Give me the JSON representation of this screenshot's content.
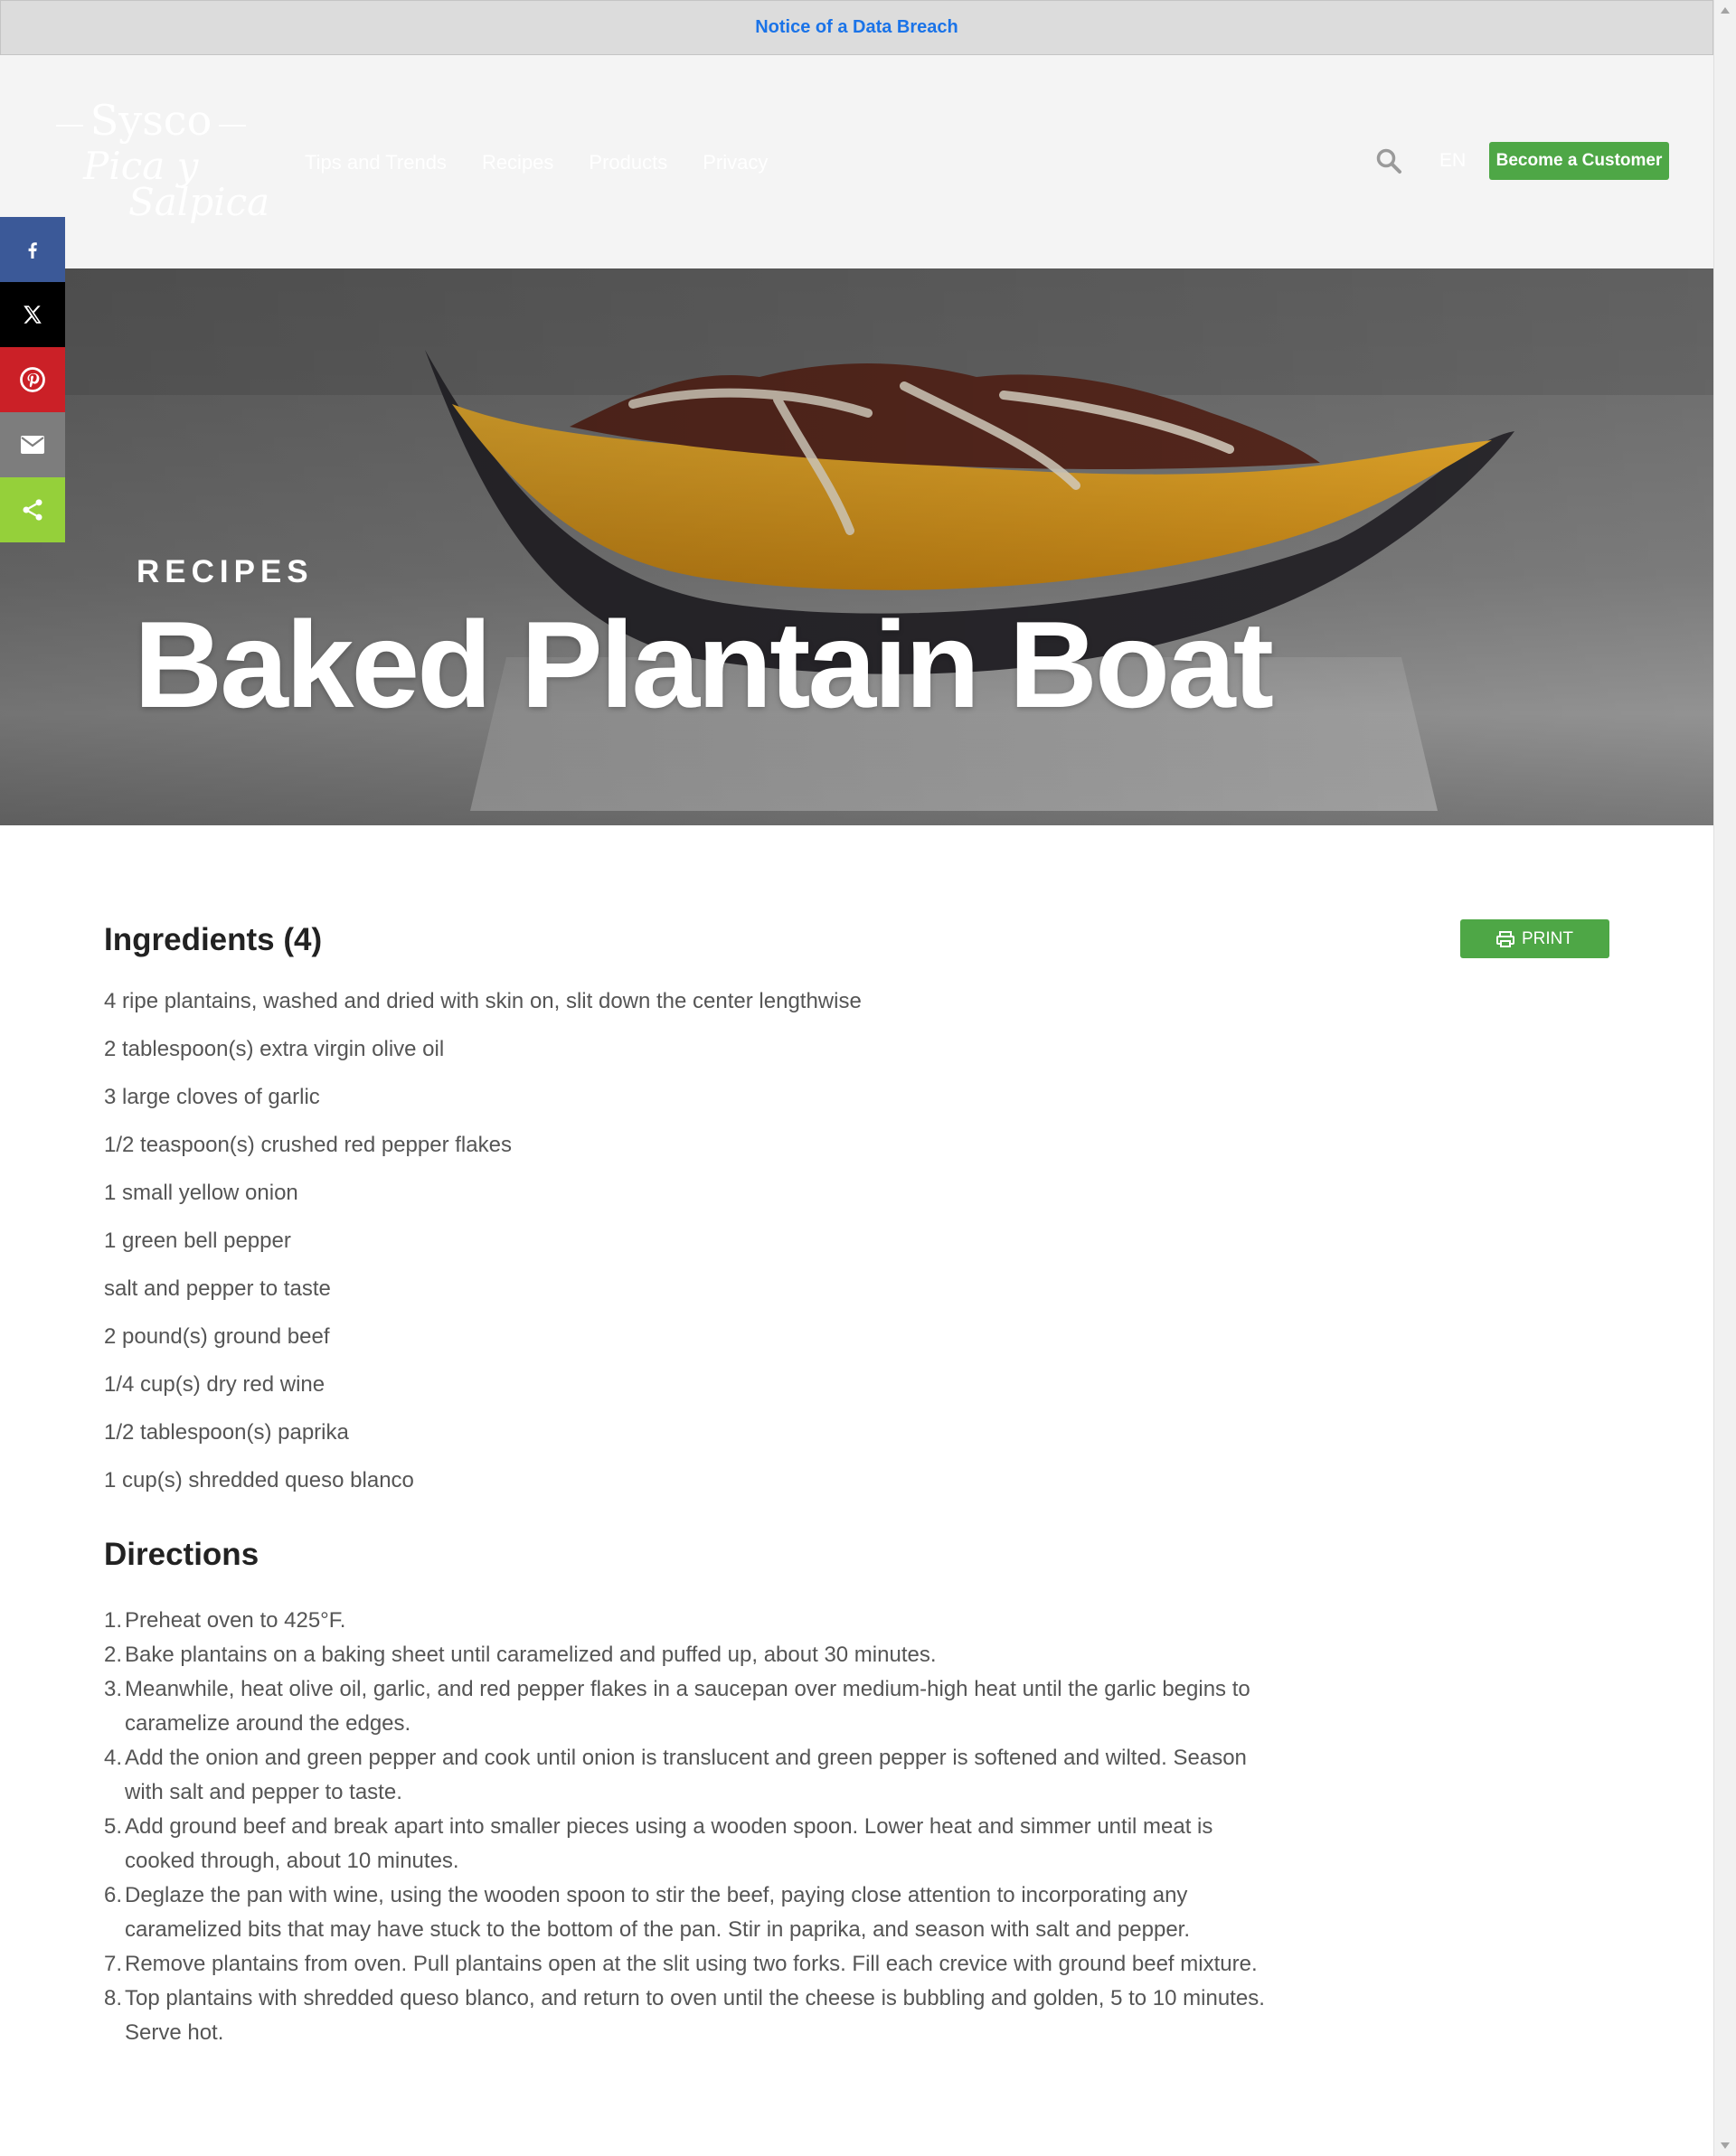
{
  "notice": {
    "label": "Notice of a Data Breach"
  },
  "header": {
    "logo": {
      "brand": "Sysco",
      "line1": "Pica y",
      "line2": "Salpica"
    },
    "nav": [
      "Tips and Trends",
      "Recipes",
      "Products",
      "Privacy"
    ],
    "search_icon": "search-icon",
    "language": "EN",
    "cta_label": "Become a Customer"
  },
  "social": [
    "facebook-icon",
    "x-icon",
    "pinterest-icon",
    "email-icon",
    "share-icon"
  ],
  "hero": {
    "eyebrow": "RECIPES",
    "title": "Baked Plantain Boat"
  },
  "ingredients": {
    "title": "Ingredients (4)",
    "print_label": "PRINT",
    "items": [
      "4 ripe plantains, washed and dried with skin on, slit down the center lengthwise",
      "2 tablespoon(s) extra virgin olive oil",
      "3 large cloves of garlic",
      "1/2 teaspoon(s) crushed red pepper flakes",
      "1 small yellow onion",
      "1 green bell pepper",
      "salt and pepper to taste",
      "2 pound(s) ground beef",
      "1/4 cup(s) dry red wine",
      "1/2 tablespoon(s) paprika",
      "1 cup(s) shredded queso blanco"
    ]
  },
  "directions": {
    "title": "Directions",
    "steps": [
      {
        "num": "1.",
        "lines": [
          "Preheat oven to 425°F."
        ]
      },
      {
        "num": "2.",
        "lines": [
          "Bake plantains on a baking sheet until caramelized and puffed up, about 30 minutes."
        ]
      },
      {
        "num": "3.",
        "lines": [
          "Meanwhile, heat olive oil, garlic, and red pepper flakes in a saucepan over medium-high heat until the garlic begins to",
          "caramelize around the edges."
        ]
      },
      {
        "num": "4.",
        "lines": [
          "Add the onion and green pepper and cook until onion is translucent and green pepper is softened and wilted. Season",
          "with salt and pepper to taste."
        ]
      },
      {
        "num": "5.",
        "lines": [
          "Add ground beef and break apart into smaller pieces using a wooden spoon. Lower heat and simmer until meat is",
          "cooked through, about 10 minutes."
        ]
      },
      {
        "num": "6.",
        "lines": [
          "Deglaze the pan with wine, using the wooden spoon to stir the beef, paying close attention to incorporating any",
          "caramelized bits that may have stuck to the bottom of the pan. Stir in paprika, and season with salt and pepper."
        ]
      },
      {
        "num": "7.",
        "lines": [
          "Remove plantains from oven. Pull plantains open at the slit using two forks. Fill each crevice with ground beef mixture."
        ]
      },
      {
        "num": "8.",
        "lines": [
          "Top plantains with shredded queso blanco, and return to oven until the cheese is bubbling and golden, 5 to 10 minutes.",
          "Serve hot."
        ]
      }
    ]
  },
  "colors": {
    "accent_green": "#4ea746",
    "notice_link": "#1a73e8",
    "facebook": "#3b5998",
    "pinterest": "#cb2027",
    "share": "#95d03a"
  }
}
